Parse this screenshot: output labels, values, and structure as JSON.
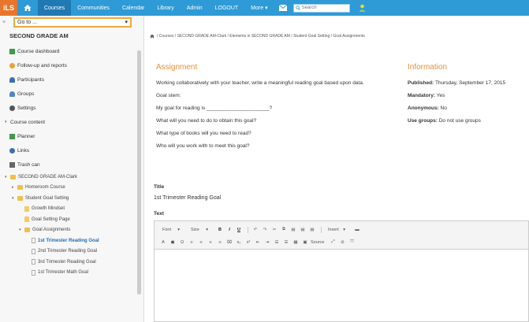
{
  "topbar": {
    "logo": "iLS",
    "nav": [
      "Courses",
      "Communities",
      "Calendar",
      "Library",
      "Admin",
      "LOGOUT",
      "More ▾"
    ],
    "search_placeholder": "Search",
    "colors": {
      "bar": "#2e9ad6",
      "active": "#1f79b3",
      "logo": "#e8752b"
    }
  },
  "sidebar": {
    "goto_label": "Go to ...",
    "course_title": "SECOND GRADE AM",
    "items": [
      {
        "label": "Course dashboard",
        "icon": "dashboard-icon"
      },
      {
        "label": "Follow-up and reports",
        "icon": "reports-icon"
      },
      {
        "label": "Participants",
        "icon": "participants-icon"
      },
      {
        "label": "Groups",
        "icon": "groups-icon"
      },
      {
        "label": "Settings",
        "icon": "gear-icon"
      }
    ],
    "content_label": "Course content",
    "content_items": [
      {
        "label": "Planner",
        "icon": "planner-icon"
      },
      {
        "label": "Links",
        "icon": "links-icon"
      },
      {
        "label": "Trash can",
        "icon": "trash-icon"
      }
    ],
    "tree": [
      {
        "label": "SECOND GRADE AM-Clark",
        "level": 0,
        "type": "folder",
        "arrow": "▾"
      },
      {
        "label": "Homeroom Course",
        "level": 1,
        "type": "folder",
        "arrow": "▸"
      },
      {
        "label": "Student Goal Setting",
        "level": 1,
        "type": "folder",
        "arrow": "▾"
      },
      {
        "label": "Growth Mindset",
        "level": 2,
        "type": "page",
        "arrow": ""
      },
      {
        "label": "Goal Setting Page",
        "level": 2,
        "type": "page",
        "arrow": ""
      },
      {
        "label": "Goal Assignments",
        "level": 2,
        "type": "folder",
        "arrow": "▾"
      },
      {
        "label": "1st Trimester Reading Goal",
        "level": 3,
        "type": "doc",
        "arrow": "",
        "selected": true
      },
      {
        "label": "2nd Trimester Reading Goal",
        "level": 3,
        "type": "doc",
        "arrow": ""
      },
      {
        "label": "3rd Trimester Reading Goal",
        "level": 3,
        "type": "doc",
        "arrow": ""
      },
      {
        "label": "1st Trimester Math Goal",
        "level": 3,
        "type": "doc",
        "arrow": ""
      }
    ]
  },
  "breadcrumb": "/ Courses / SECOND GRADE AM-Clark / Elements in SECOND GRADE AM / Student Goal Setting / Goal Assignments",
  "assignment": {
    "heading": "Assignment",
    "intro": "Working collaboratively with your teacher, write a meaningful reading goal based upon data.",
    "stem": "Goal stem:",
    "goal_line": "My goal for reading is ______________________?",
    "q1": "What will you need to do to obtain this goal?",
    "q2": "What type of books will you need to read?",
    "q3": "Who will you work with to meet this goal?"
  },
  "information": {
    "heading": "Information",
    "published_label": "Published:",
    "published_value": "Thursday, September 17, 2015",
    "mandatory_label": "Mandatory:",
    "mandatory_value": "Yes",
    "anonymous_label": "Anonymous:",
    "anonymous_value": "No",
    "groups_label": "Use groups:",
    "groups_value": "Do not use groups"
  },
  "form": {
    "title_label": "Title",
    "title_value": "1st Trimester Reading Goal",
    "text_label": "Text",
    "toolbar_font": "Font",
    "toolbar_size": "Size",
    "toolbar_insert": "Insert",
    "toolbar_source": "Source"
  }
}
